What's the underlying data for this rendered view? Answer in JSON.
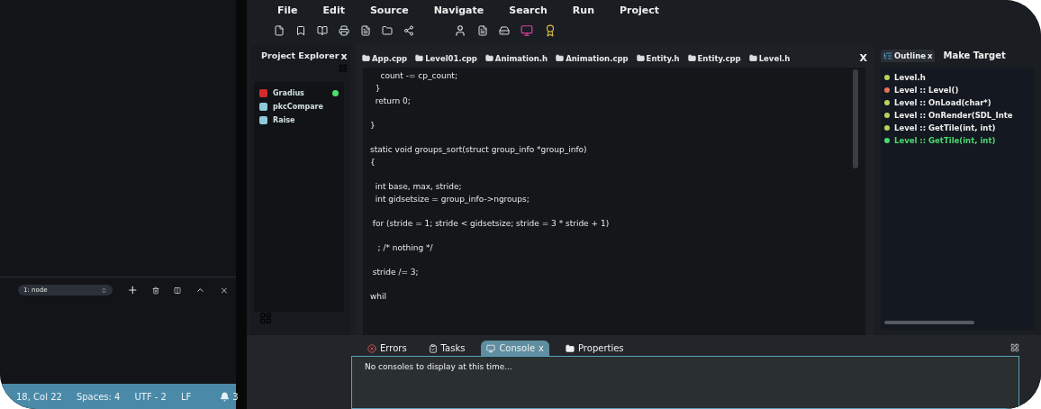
{
  "terminal": {
    "dropdown": "1: node"
  },
  "status_bar": {
    "position": "18, Col 22",
    "spaces": "Spaces: 4",
    "encoding": "UTF - 2",
    "eol": "LF",
    "notifications": "3"
  },
  "menu": [
    "File",
    "Edit",
    "Source",
    "Navigate",
    "Search",
    "Run",
    "Project"
  ],
  "project_explorer": {
    "title": "Project Explorer",
    "close": "x",
    "items": [
      {
        "label": "Gradius",
        "color": "#d42a2a",
        "active": true
      },
      {
        "label": "pkcCompare",
        "color": "#8fc8d8",
        "active": false
      },
      {
        "label": "Raise",
        "color": "#8fc8d8",
        "active": false
      }
    ]
  },
  "editor_tabs": [
    {
      "label": "App.cpp",
      "selected": false
    },
    {
      "label": "Level01.cpp",
      "selected": false
    },
    {
      "label": "Animation.h",
      "selected": false
    },
    {
      "label": "Animation.cpp",
      "selected": false
    },
    {
      "label": "Entity.h",
      "selected": false
    },
    {
      "label": "Entity.cpp",
      "selected": false
    },
    {
      "label": "Level.h",
      "selected": false
    }
  ],
  "editor_close": "X",
  "code_blocks": [
    [
      "    count -= cp_count;",
      "  }",
      "  return 0;"
    ],
    [
      "}"
    ],
    [
      "static void groups_sort(struct group_info *group_info)",
      "{"
    ],
    [
      "  int base, max, stride;",
      "  int gidsetsize = group_info->ngroups;"
    ],
    [
      " for (stride = 1; stride < gidsetsize; stride = 3 * stride + 1)"
    ],
    [
      "   ; /* nothing */"
    ],
    [
      " stride /= 3;"
    ],
    [
      "whil"
    ]
  ],
  "outline": {
    "tabs": [
      {
        "label": "Outline",
        "selected": true,
        "close": "x"
      },
      {
        "label": "Make Target",
        "selected": false
      }
    ],
    "items": [
      {
        "label": "Level.h",
        "color": "#b5d45a",
        "selected": false
      },
      {
        "label": "Level :: Level()",
        "color": "#e8735a",
        "selected": false
      },
      {
        "label": "Level :: OnLoad(char*)",
        "color": "#b5d45a",
        "selected": false
      },
      {
        "label": "Level :: OnRender(SDL_Inte",
        "color": "#b5d45a",
        "selected": false
      },
      {
        "label": "Level :: GetTile(int, int)",
        "color": "#b5d45a",
        "selected": false
      },
      {
        "label": "Level :: GetTile(int, int)",
        "color": "#4cd870",
        "selected": true
      }
    ]
  },
  "bottom_tabs": [
    {
      "label": "Errors",
      "kind": "errors",
      "selected": false
    },
    {
      "label": "Tasks",
      "kind": "tasks",
      "selected": false
    },
    {
      "label": "Console",
      "kind": "console",
      "selected": true,
      "close": "x"
    },
    {
      "label": "Properties",
      "kind": "properties",
      "selected": false
    }
  ],
  "console_message": "No consoles to display at this time..."
}
